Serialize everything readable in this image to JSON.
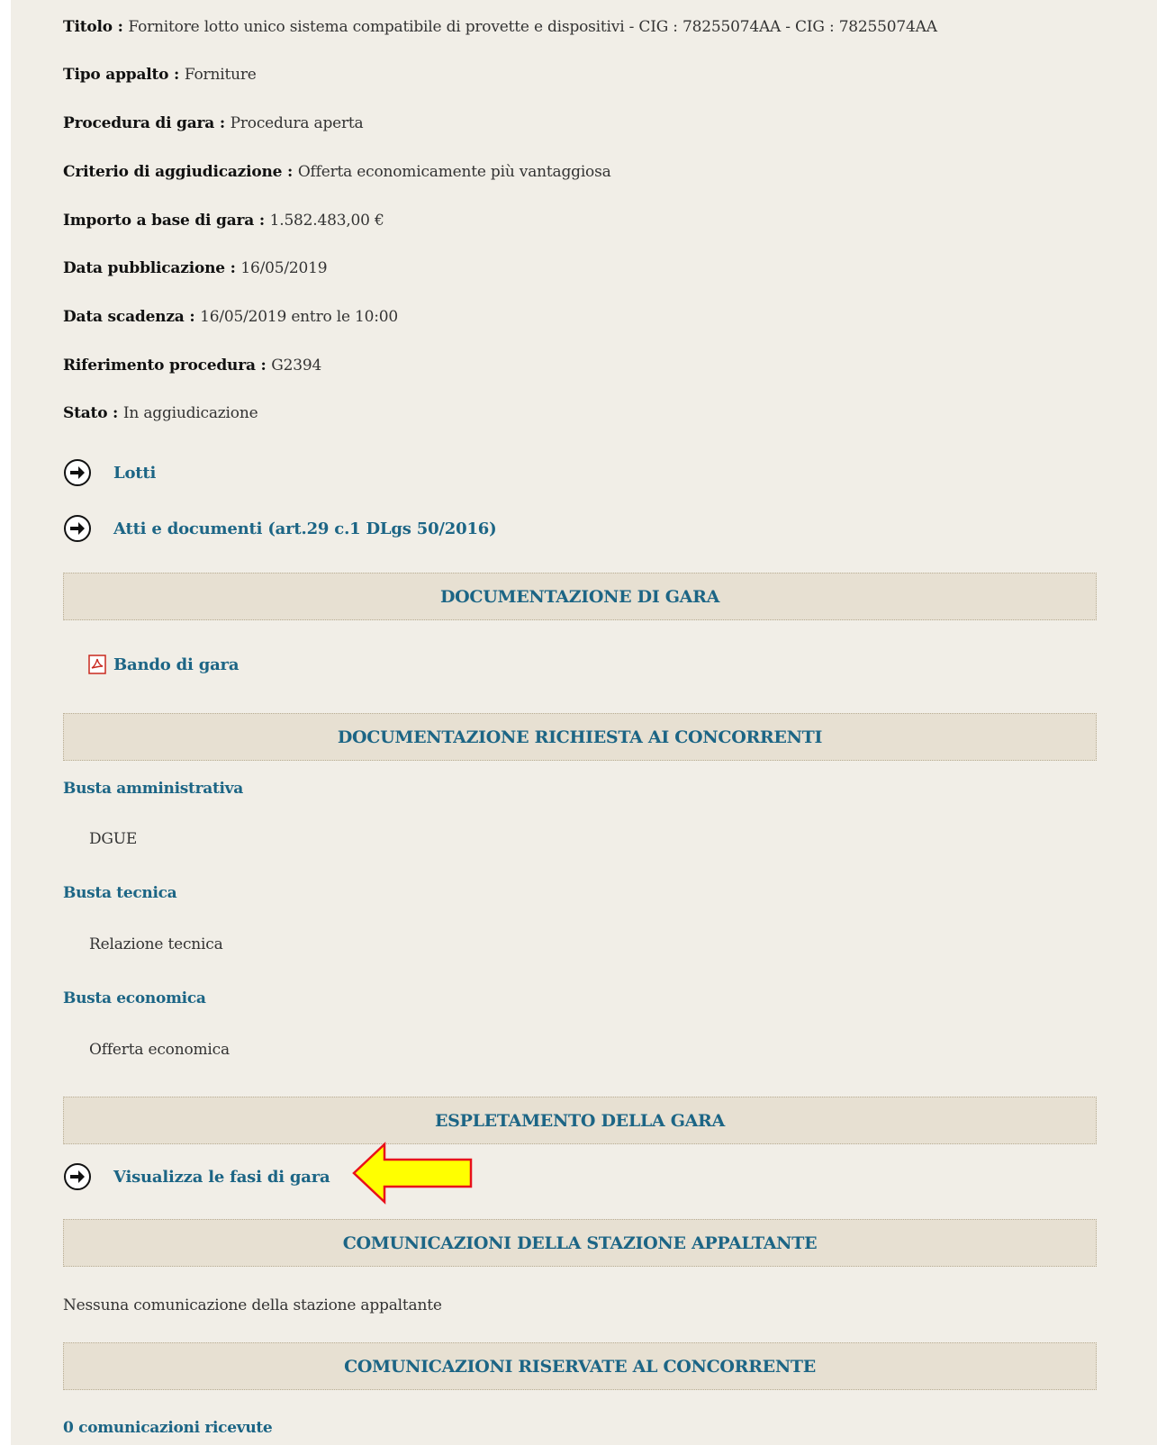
{
  "details": [
    {
      "key": "Titolo",
      "sep": " : ",
      "value": "Fornitore lotto unico sistema compatibile di provette e dispositivi - CIG : 78255074AA - CIG : 78255074AA"
    },
    {
      "key": "Tipo appalto",
      "sep": " : ",
      "value": "Forniture"
    },
    {
      "key": "Procedura di gara",
      "sep": " : ",
      "value": "Procedura aperta"
    },
    {
      "key": "Criterio di aggiudicazione",
      "sep": " : ",
      "value": "Offerta economicamente più vantaggiosa"
    },
    {
      "key": "Importo a base di gara",
      "sep": " : ",
      "value": "1.582.483,00 €"
    },
    {
      "key": "Data pubblicazione",
      "sep": " : ",
      "value": "16/05/2019"
    },
    {
      "key": "Data scadenza",
      "sep": " : ",
      "value": "16/05/2019 entro le 10:00"
    },
    {
      "key": "Riferimento procedura",
      "sep": " : ",
      "value": "G2394"
    },
    {
      "key": "Stato",
      "sep": " : ",
      "value": "In aggiudicazione"
    }
  ],
  "links": {
    "lotti": "Lotti",
    "atti": "Atti e documenti (art.29 c.1 DLgs 50/2016)",
    "fasi": "Visualizza le fasi di gara"
  },
  "sections": {
    "documentazione_gara": "DOCUMENTAZIONE DI GARA",
    "documentazione_richiesta": "DOCUMENTAZIONE RICHIESTA AI CONCORRENTI",
    "espletamento": "ESPLETAMENTO DELLA GARA",
    "comunicazioni_stazione": "COMUNICAZIONI DELLA STAZIONE APPALTANTE",
    "comunicazioni_riservate": "COMUNICAZIONI RISERVATE AL CONCORRENTE"
  },
  "bando": {
    "label": "Bando di gara",
    "icon": "pdf-icon"
  },
  "buste": {
    "amministrativa": {
      "label": "Busta amministrativa",
      "doc": "DGUE"
    },
    "tecnica": {
      "label": "Busta tecnica",
      "doc": "Relazione tecnica"
    },
    "economica": {
      "label": "Busta economica",
      "doc": "Offerta economica"
    }
  },
  "comunicazioni": {
    "nessuna": "Nessuna comunicazione della stazione appaltante",
    "ricevute": "0 comunicazioni ricevute"
  },
  "colors": {
    "page_bg": "#f1eee7",
    "section_bg": "#e7e0d2",
    "link": "#1c6585",
    "callout_fill": "#ffff00",
    "callout_stroke": "#e8101a"
  },
  "icons": {
    "arrow": "circle-arrow-right-icon",
    "callout": "callout-arrow-icon"
  }
}
